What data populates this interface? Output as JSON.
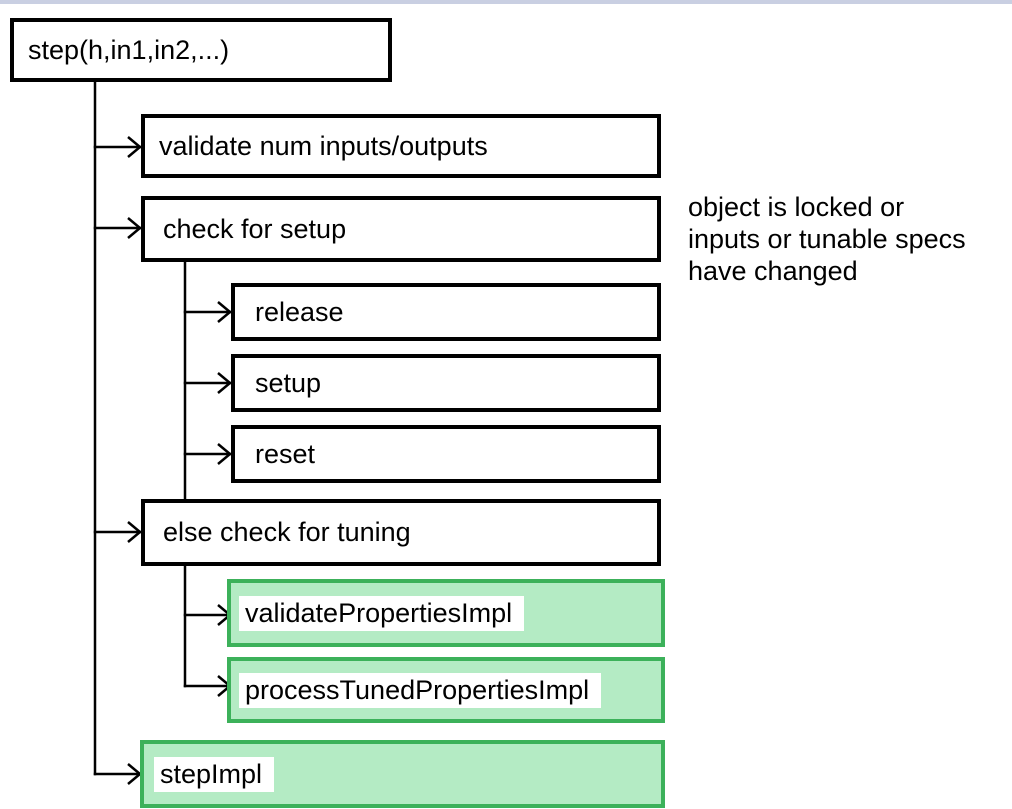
{
  "diagram": {
    "root": {
      "label": "step(h,in1,in2,...)"
    },
    "nodes": {
      "validate": {
        "label": "validate num inputs/outputs"
      },
      "check_setup": {
        "label": "check for setup"
      },
      "release": {
        "label": "release"
      },
      "setup": {
        "label": "setup"
      },
      "reset": {
        "label": "reset"
      },
      "else_tuning": {
        "label": "else check for tuning"
      },
      "validate_props": {
        "label": "validatePropertiesImpl"
      },
      "process_tuned": {
        "label": "processTunedPropertiesImpl"
      },
      "step_impl": {
        "label": "stepImpl"
      }
    },
    "note": {
      "lines": [
        "object is locked or",
        "inputs or tunable specs",
        "have changed"
      ]
    },
    "colors": {
      "border": "#000000",
      "highlight_border": "#3cb15a",
      "highlight_fill": "#b4ebc4"
    }
  }
}
